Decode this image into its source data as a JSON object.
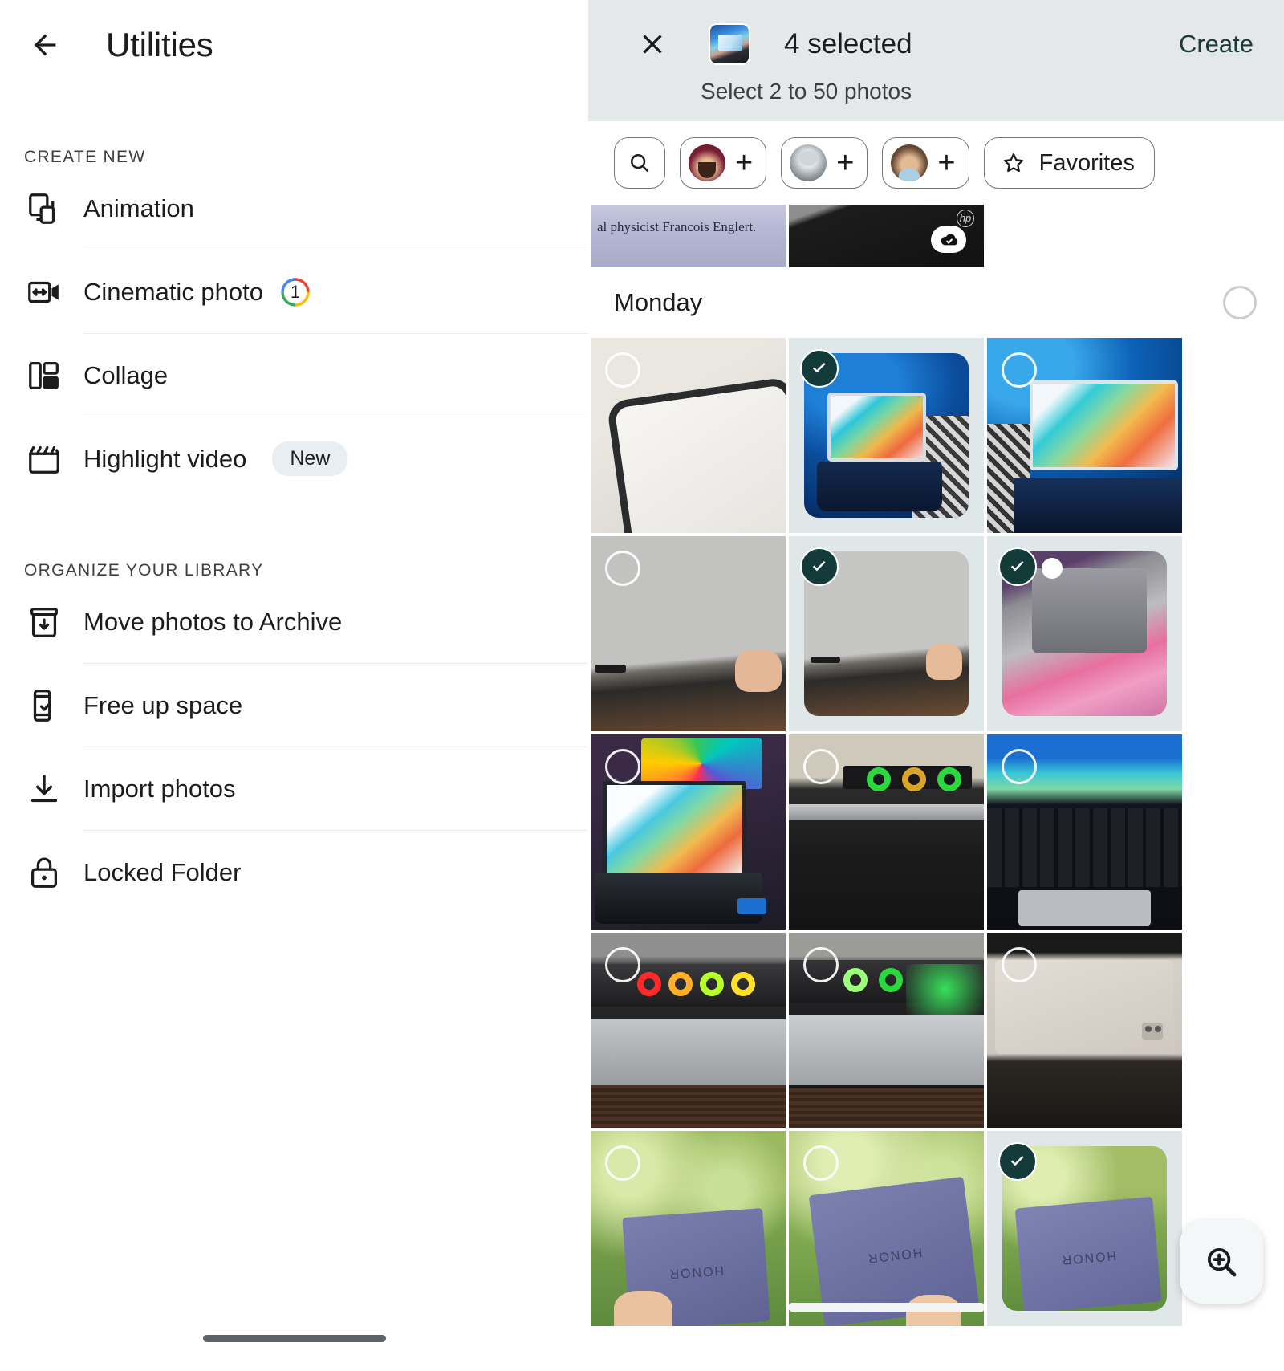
{
  "left": {
    "appbar": {
      "back_icon": "arrow-back-icon",
      "title": "Utilities"
    },
    "sections": [
      {
        "label": "CREATE NEW",
        "items": [
          {
            "icon": "animation-icon",
            "label": "Animation",
            "badge": null
          },
          {
            "icon": "cinematic-photo-icon",
            "label": "Cinematic photo",
            "badge": "1",
            "badge_type": "count-ring"
          },
          {
            "icon": "collage-icon",
            "label": "Collage",
            "badge": null
          },
          {
            "icon": "highlight-video-icon",
            "label": "Highlight video",
            "badge": "New",
            "badge_type": "pill"
          }
        ]
      },
      {
        "label": "ORGANIZE YOUR LIBRARY",
        "items": [
          {
            "icon": "archive-icon",
            "label": "Move photos to Archive",
            "badge": null
          },
          {
            "icon": "free-up-space-icon",
            "label": "Free up space",
            "badge": null
          },
          {
            "icon": "import-photos-icon",
            "label": "Import photos",
            "badge": null
          },
          {
            "icon": "lock-icon",
            "label": "Locked Folder",
            "badge": null
          }
        ]
      }
    ]
  },
  "right": {
    "appbar": {
      "close_icon": "close-icon",
      "thumb_alt": "selection-thumbnail",
      "count_label": "4 selected",
      "hint": "Select 2 to 50 photos",
      "create_label": "Create"
    },
    "chips": [
      {
        "name": "search",
        "icon": "search-icon",
        "label": ""
      },
      {
        "name": "person-1",
        "icon": "person-avatar",
        "label": "",
        "action_icon": "plus-icon"
      },
      {
        "name": "person-2",
        "icon": "person-avatar",
        "label": "",
        "action_icon": "plus-icon"
      },
      {
        "name": "person-3",
        "icon": "person-avatar",
        "label": "",
        "action_icon": "plus-icon"
      },
      {
        "name": "favorites",
        "icon": "star-icon",
        "label": "Favorites"
      }
    ],
    "strip": [
      {
        "caption": "al physicist Francois Englert.",
        "badge": null
      },
      {
        "caption": "",
        "badge": "cloud-backed-up-icon",
        "brand": "hp"
      }
    ],
    "day_group": {
      "label": "Monday",
      "select_all_icon": "circle-outline-icon",
      "selected": false
    },
    "grid": [
      {
        "id": "p1",
        "art": "p-phone",
        "selected": false,
        "alt": "phone showing browser history"
      },
      {
        "id": "p2",
        "art": "p-laptop-blue",
        "selected": true,
        "alt": "laptop with blue wallpaper on rug"
      },
      {
        "id": "p3",
        "art": "p-laptop-blue2",
        "selected": false,
        "alt": "laptop with blue wallpaper closeup"
      },
      {
        "id": "p4",
        "art": "p-edge-a",
        "selected": false,
        "alt": "laptop edge ports with hand"
      },
      {
        "id": "p5",
        "art": "p-edge-b",
        "selected": true,
        "alt": "laptop edge ports with hand"
      },
      {
        "id": "p6",
        "art": "p-blur-pink",
        "selected": true,
        "alt": "blurred laptop over pink cloth"
      },
      {
        "id": "p7",
        "art": "p-desk-rgb",
        "selected": false,
        "alt": "laptop on desk with rgb monitor"
      },
      {
        "id": "p8",
        "art": "p-lid-green",
        "selected": false,
        "alt": "closed laptop with green lights"
      },
      {
        "id": "p9",
        "art": "p-kb-rainbow",
        "selected": false,
        "alt": "laptop keyboard closeup"
      },
      {
        "id": "p10",
        "art": "p-rgb-warm",
        "selected": false,
        "alt": "laptop with warm rgb lights"
      },
      {
        "id": "p11",
        "art": "p-rgb-cool",
        "selected": false,
        "alt": "laptop with green rgb lights"
      },
      {
        "id": "p12",
        "art": "p-tablet",
        "selected": false,
        "alt": "white tablet back on desk"
      },
      {
        "id": "p13",
        "art": "p-outdoor-a",
        "selected": false,
        "alt": "purple laptop held outdoors",
        "lid_brand": "HONOR"
      },
      {
        "id": "p14",
        "art": "p-outdoor-b",
        "selected": false,
        "alt": "purple laptop held outdoors",
        "lid_brand": "HONOR"
      },
      {
        "id": "p15",
        "art": "p-outdoor-c",
        "selected": true,
        "alt": "purple laptop held outdoors",
        "lid_brand": "HONOR"
      }
    ],
    "fab": {
      "icon": "zoom-in-icon",
      "name": "zoom-in-fab"
    }
  },
  "colors": {
    "accent_selected": "#123b3a",
    "appbar_bg": "#e4e8e8",
    "selected_cell_bg": "#dfe7e8",
    "divider": "#e8eaed",
    "text_primary": "#1b1c1d",
    "badge_new_bg": "#e8eef1"
  }
}
